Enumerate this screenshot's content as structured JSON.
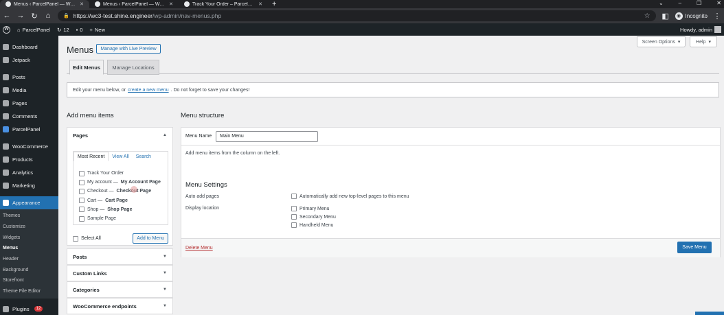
{
  "browser": {
    "tabs": [
      {
        "label": "Menus ‹ ParcelPanel — WordP",
        "active": true
      },
      {
        "label": "Menus ‹ ParcelPanel — WordP",
        "active": false
      },
      {
        "label": "Track Your Order – ParcelPanel",
        "active": false
      }
    ],
    "new_tab": "+",
    "url_host": "https://wc3-test.shine.engineer",
    "url_path": "/wp-admin/nav-menus.php",
    "profile": "Incognito"
  },
  "adminbar": {
    "site_name": "ParcelPanel",
    "updates_count": "12",
    "comments_count": "0",
    "new_label": "New",
    "howdy": "Howdy, admin"
  },
  "sidebar": {
    "items": [
      {
        "label": "Dashboard"
      },
      {
        "label": "Jetpack"
      },
      {
        "label": "Posts"
      },
      {
        "label": "Media"
      },
      {
        "label": "Pages"
      },
      {
        "label": "Comments"
      },
      {
        "label": "ParcelPanel"
      },
      {
        "label": "WooCommerce"
      },
      {
        "label": "Products"
      },
      {
        "label": "Analytics"
      },
      {
        "label": "Marketing"
      },
      {
        "label": "Appearance"
      }
    ],
    "subitems": [
      {
        "label": "Themes"
      },
      {
        "label": "Customize"
      },
      {
        "label": "Widgets"
      },
      {
        "label": "Menus"
      },
      {
        "label": "Header"
      },
      {
        "label": "Background"
      },
      {
        "label": "Storefront"
      },
      {
        "label": "Theme File Editor"
      }
    ],
    "plugins": {
      "label": "Plugins",
      "badge": "12"
    }
  },
  "page": {
    "title": "Menus",
    "live_preview": "Manage with Live Preview",
    "screen_options": "Screen Options",
    "help": "Help",
    "tabs": [
      "Edit Menus",
      "Manage Locations"
    ],
    "notice_pre": "Edit your menu below, or",
    "notice_link": "create a new menu",
    "notice_post": ". Do not forget to save your changes!"
  },
  "add_items": {
    "heading": "Add menu items",
    "pages_title": "Pages",
    "inner_tabs": [
      "Most Recent",
      "View All",
      "Search"
    ],
    "pages": [
      {
        "name": "Track Your Order",
        "suffix": ""
      },
      {
        "name": "My account —",
        "suffix": "My Account Page"
      },
      {
        "name": "Checkout —",
        "suffix": "Checkout Page"
      },
      {
        "name": "Cart —",
        "suffix": "Cart Page"
      },
      {
        "name": "Shop —",
        "suffix": "Shop Page"
      },
      {
        "name": "Sample Page",
        "suffix": ""
      }
    ],
    "select_all": "Select All",
    "add_button": "Add to Menu",
    "sections": [
      "Posts",
      "Custom Links",
      "Categories",
      "WooCommerce endpoints"
    ]
  },
  "structure": {
    "heading": "Menu structure",
    "menu_name_label": "Menu Name",
    "menu_name_value": "Main Menu",
    "instructions": "Add menu items from the column on the left.",
    "settings_heading": "Menu Settings",
    "auto_add_label": "Auto add pages",
    "auto_add_option": "Automatically add new top-level pages to this menu",
    "display_location_label": "Display location",
    "locations": [
      "Primary Menu",
      "Secondary Menu",
      "Handheld Menu"
    ],
    "delete_link": "Delete Menu",
    "save_button": "Save Menu"
  },
  "colors": {
    "accent": "#2271b1",
    "sidebar_bg": "#1d2327",
    "danger": "#b32d2e"
  }
}
